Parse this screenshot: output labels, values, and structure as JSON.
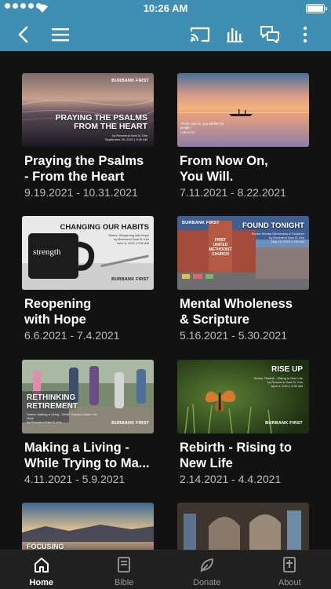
{
  "status_bar": {
    "time": "10:26 AM"
  },
  "app_bar": {
    "icons": [
      "back-arrow-icon",
      "menu-icon",
      "cast-icon",
      "equalizer-icon",
      "chat-icon",
      "more-vert-icon"
    ]
  },
  "sermon_series": [
    {
      "title_line1": "Praying the Psalms",
      "title_line2": "- From the Heart",
      "dates": "9.19.2021 - 10.31.2021",
      "thumb": {
        "overlay_line1": "PRAYING THE PSALMS",
        "overlay_line2": "FROM THE HEART",
        "brand": "BURBANK FIRST",
        "info": "by Reverend Sam B. Kim",
        "info2": "September 26, 2021 | 9:30 AM"
      }
    },
    {
      "title_line1": "From Now On,",
      "title_line2": "You Will.",
      "dates": "7.11.2021 - 8.22.2021",
      "thumb": {
        "caption": "\"From now on, you will fish for people.\"",
        "caption2": "Luke 5:10"
      }
    },
    {
      "title_line1": "Reopening",
      "title_line2": "with Hope",
      "dates": "6.6.2021 - 7.4.2021",
      "thumb": {
        "overlay_line1": "CHANGING OUR HABITS",
        "mug_text": "strength",
        "brand": "BURBANK FIRST",
        "info": "Series: Reopening with Hope",
        "info2": "by Reverend Sam B. Kim",
        "info3": "June 6, 2021 | 9:30 AM"
      }
    },
    {
      "title_line1": "Mental Wholeness",
      "title_line2": "& Scripture",
      "dates": "5.16.2021 - 5.30.2021",
      "thumb": {
        "overlay_line1": "FOUND TONIGHT",
        "brand": "BURBANK FIRST",
        "building_text": "FIRST UNITED METHODIST CHURCH",
        "info": "Series: Mental Wholeness & Scripture",
        "info2": "by Reverend Sam B. Kim",
        "info3": "May 16, 2021 | 9:30 AM"
      }
    },
    {
      "title_line1": "Making a Living -",
      "title_line2": "While Trying to Ma...",
      "dates": "4.11.2021 - 5.9.2021",
      "thumb": {
        "overlay_line1": "RETHINKING",
        "overlay_line2": "RETIREMENT",
        "brand": "BURBANK FIRST",
        "info": "Series: Making a Living - While Trying to Make Life Work",
        "info2": "by Reverend Sam B. Kim"
      }
    },
    {
      "title_line1": "Rebirth - Rising to",
      "title_line2": "New Life",
      "dates": "2.14.2021 - 4.4.2021",
      "thumb": {
        "overlay_line1": "RISE UP",
        "brand": "BURBANK FIRST",
        "info": "Series: Rebirth - Rising to New Life",
        "info2": "by Reverend Sam B. Kim",
        "info3": "April 4, 2021 | 9:30 AM"
      }
    },
    {
      "thumb": {
        "overlay_line1": "FOCUSING"
      }
    },
    {
      "thumb": {}
    }
  ],
  "tab_bar": {
    "tabs": [
      {
        "label": "Home",
        "icon": "home-icon",
        "active": true
      },
      {
        "label": "Bible",
        "icon": "bible-icon",
        "active": false
      },
      {
        "label": "Donate",
        "icon": "donate-leaf-icon",
        "active": false
      },
      {
        "label": "About",
        "icon": "about-icon",
        "active": false
      }
    ]
  },
  "colors": {
    "brand_bar": "#3f8fb4",
    "background": "#121212",
    "tab_bar": "#202020",
    "title_text": "#ffffff",
    "date_text": "#bdbdbd",
    "inactive_tab": "#9a9a9a"
  }
}
